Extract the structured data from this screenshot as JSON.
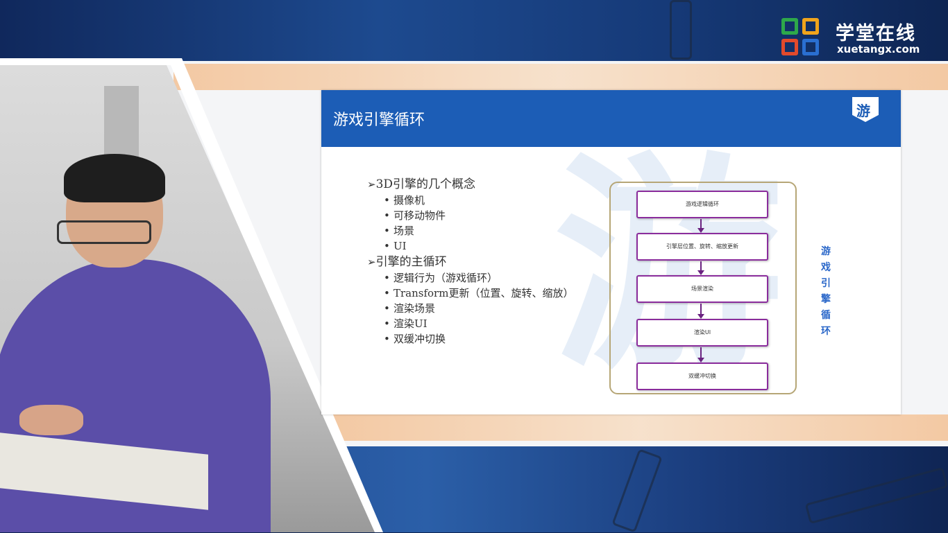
{
  "brand": {
    "name": "学堂在线",
    "url": "xuetangx.com",
    "colors": [
      "#2ea84a",
      "#f0a41c",
      "#e24a2c",
      "#2a6fd1"
    ]
  },
  "slide": {
    "title": "游戏引擎循环",
    "badge": "游",
    "sections": [
      {
        "heading": "3D引擎的几个概念",
        "items": [
          "摄像机",
          "可移动物件",
          "场景",
          "UI"
        ]
      },
      {
        "heading": "引擎的主循环",
        "items": [
          "逻辑行为（游戏循环）",
          "Transform更新（位置、旋转、缩放）",
          "渲染场景",
          "渲染UI",
          "双缓冲切换"
        ]
      }
    ],
    "flow_nodes": [
      "游戏逻辑循环",
      "引擎层位置、旋转、缩放更新",
      "场景渲染",
      "渲染UI",
      "双缓冲切换"
    ],
    "vertical_label": "游戏引擎循环",
    "accent_color": "#1c5db6"
  }
}
